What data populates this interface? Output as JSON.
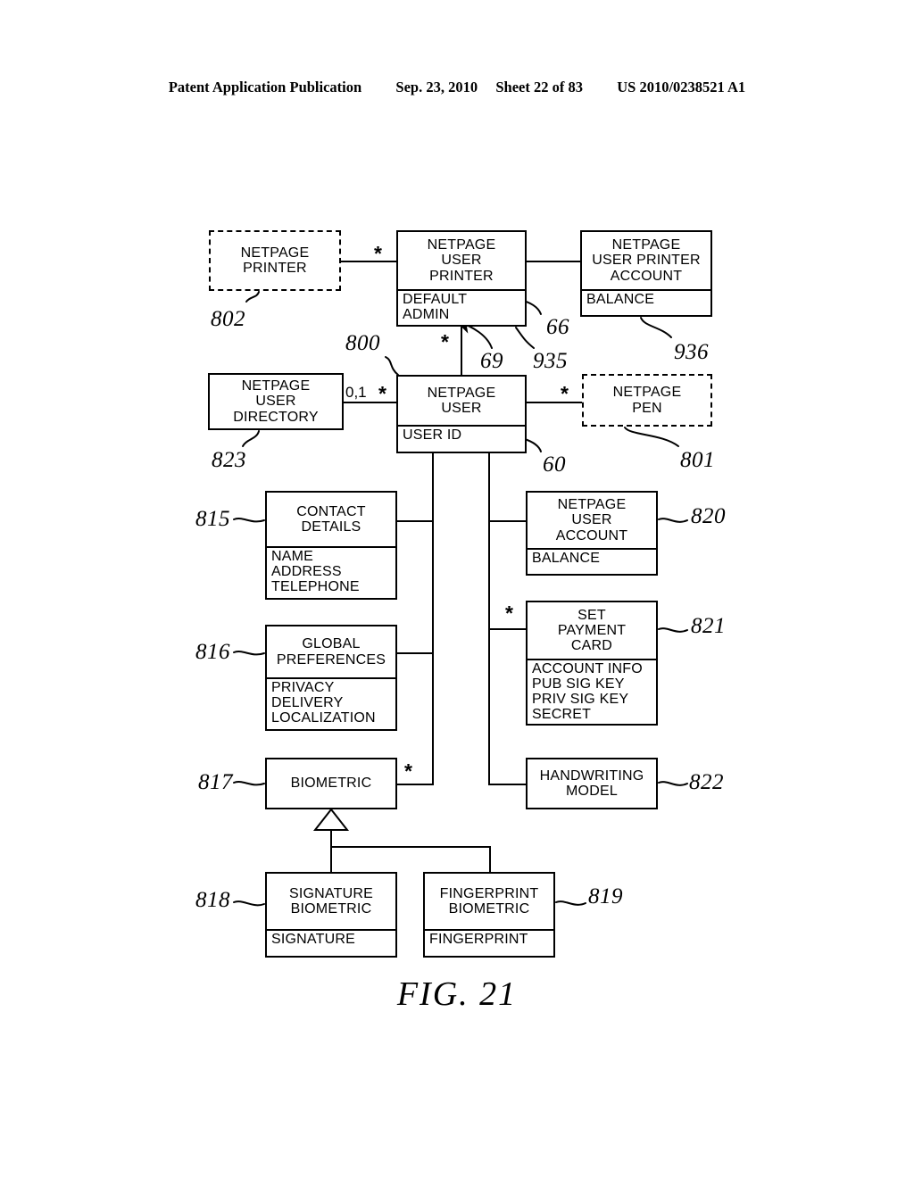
{
  "header": {
    "publication": "Patent Application Publication",
    "date": "Sep. 23, 2010",
    "sheet": "Sheet 22 of 83",
    "patent_number": "US 2010/0238521 A1"
  },
  "figure": {
    "caption": "FIG. 21"
  },
  "boxes": {
    "netpage_printer": {
      "name": "NETPAGE\nPRINTER",
      "attrs": "",
      "ref": "802",
      "style": "dashed"
    },
    "netpage_user_printer": {
      "name": "NETPAGE\nUSER\nPRINTER",
      "attrs": "DEFAULT\nADMIN",
      "ref": "935",
      "style": "solid"
    },
    "netpage_user_printer_account": {
      "name": "NETPAGE\nUSER PRINTER\nACCOUNT",
      "attrs": "BALANCE",
      "ref": "936",
      "style": "solid"
    },
    "netpage_user_directory": {
      "name": "NETPAGE\nUSER\nDIRECTORY",
      "attrs": "",
      "ref": "823",
      "style": "solid"
    },
    "netpage_user": {
      "name": "NETPAGE\nUSER",
      "attrs": "USER ID",
      "ref": "800",
      "style": "solid"
    },
    "netpage_pen": {
      "name": "NETPAGE\nPEN",
      "attrs": "",
      "ref": "801",
      "style": "dashed"
    },
    "contact_details": {
      "name": "CONTACT\nDETAILS",
      "attrs": "NAME\nADDRESS\nTELEPHONE",
      "ref": "815",
      "style": "solid"
    },
    "netpage_user_account": {
      "name": "NETPAGE\nUSER\nACCOUNT",
      "attrs": "BALANCE",
      "ref": "820",
      "style": "solid"
    },
    "global_preferences": {
      "name": "GLOBAL\nPREFERENCES",
      "attrs": "PRIVACY\nDELIVERY\nLOCALIZATION",
      "ref": "816",
      "style": "solid"
    },
    "set_payment_card": {
      "name": "SET\nPAYMENT\nCARD",
      "attrs": "ACCOUNT INFO\nPUB SIG KEY\nPRIV SIG KEY\nSECRET",
      "ref": "821",
      "style": "solid"
    },
    "biometric": {
      "name": "BIOMETRIC",
      "attrs": "",
      "ref": "817",
      "style": "solid"
    },
    "handwriting_model": {
      "name": "HANDWRITING\nMODEL",
      "attrs": "",
      "ref": "822",
      "style": "solid"
    },
    "signature_biometric": {
      "name": "SIGNATURE\nBIOMETRIC",
      "attrs": "SIGNATURE",
      "ref": "818",
      "style": "solid"
    },
    "fingerprint_biometric": {
      "name": "FINGERPRINT\nBIOMETRIC",
      "attrs": "FINGERPRINT",
      "ref": "819",
      "style": "solid"
    }
  },
  "multiplicities": {
    "printer_to_user_printer": "*",
    "user_printer_to_user": "*",
    "directory_to_user": "0,1",
    "user_to_directory": "*",
    "user_to_pen": "*",
    "user_to_payment_card": "*",
    "biometric_to_user": "*"
  },
  "callouts": {
    "default_attr": "66",
    "admin_attr": "69",
    "user_printer_class": "935",
    "user_id_attr": "60"
  }
}
